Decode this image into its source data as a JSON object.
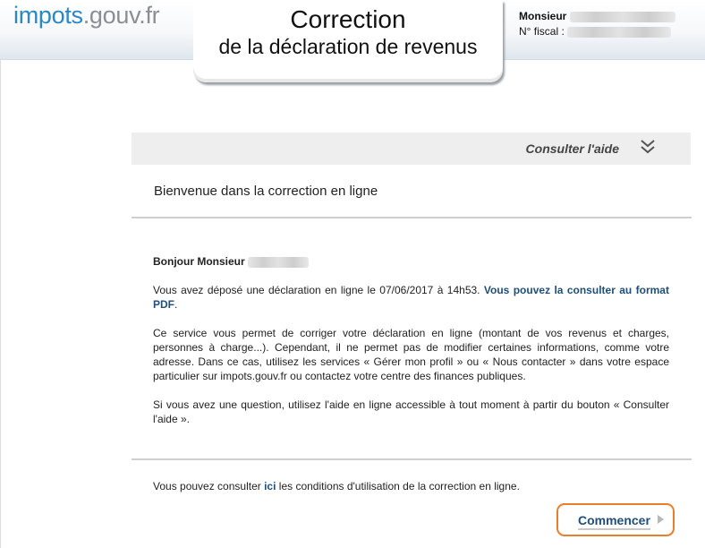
{
  "header": {
    "logo_part1": "impots",
    "logo_part2": ".gouv.fr",
    "title_line1": "Correction",
    "title_line2": "de la déclaration de revenus",
    "user_name_label": "Monsieur",
    "fiscal_label": "N° fiscal :"
  },
  "help": {
    "label": "Consulter l'aide",
    "icon": "double-chevron-down-icon"
  },
  "welcome": "Bienvenue dans la correction en ligne",
  "content": {
    "greeting": "Bonjour Monsieur",
    "p1_text": "Vous avez déposé une déclaration en ligne le 07/06/2017 à 14h53.",
    "p1_link": "Vous pouvez la consulter au format PDF",
    "p1_end": ".",
    "p2": "Ce service vous permet de corriger votre déclaration en ligne (montant de vos revenus et charges, personnes à charge...). Cependant, il ne permet pas de modifier certaines informations, comme votre adresse. Dans ce cas, utilisez les services « Gérer mon profil » ou « Nous contacter » dans votre espace particulier sur impots.gouv.fr ou contactez votre centre des finances publiques.",
    "p3": "Si vous avez une question, utilisez l'aide en ligne accessible à tout moment à partir du bouton « Consulter l'aide »."
  },
  "footer": {
    "cgu_before": "Vous pouvez consulter",
    "cgu_link": "ici",
    "cgu_after": "les conditions d'utilisation de la correction en ligne.",
    "start_label": "Commencer"
  },
  "colors": {
    "accent": "#e87f2a",
    "link": "#1e4f7a",
    "logo_blue": "#2b87c6"
  }
}
